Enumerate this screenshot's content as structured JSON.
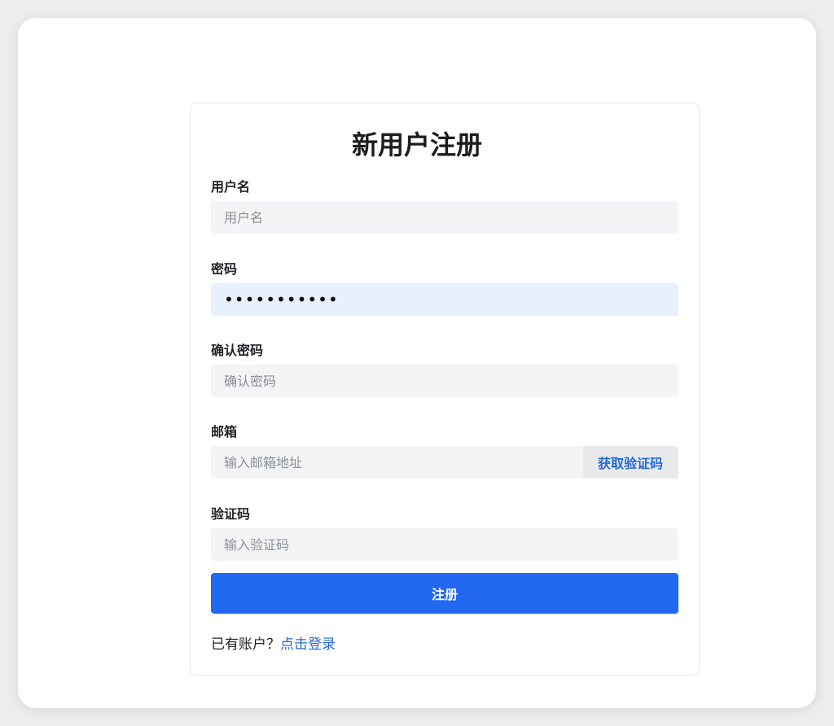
{
  "form": {
    "title": "新用户注册",
    "username": {
      "label": "用户名",
      "placeholder": "用户名",
      "value": ""
    },
    "password": {
      "label": "密码",
      "value": "•••••••••••"
    },
    "confirm_password": {
      "label": "确认密码",
      "placeholder": "确认密码",
      "value": ""
    },
    "email": {
      "label": "邮箱",
      "placeholder": "输入邮箱地址",
      "value": "",
      "code_button": "获取验证码"
    },
    "verification_code": {
      "label": "验证码",
      "placeholder": "输入验证码",
      "value": ""
    },
    "submit_label": "注册",
    "footer": {
      "prompt": "已有账户？",
      "login_link": "点击登录"
    }
  },
  "colors": {
    "primary": "#2268f0",
    "link": "#2468d6",
    "input_bg": "#f3f4f5",
    "autofill_bg": "#e8effd"
  }
}
